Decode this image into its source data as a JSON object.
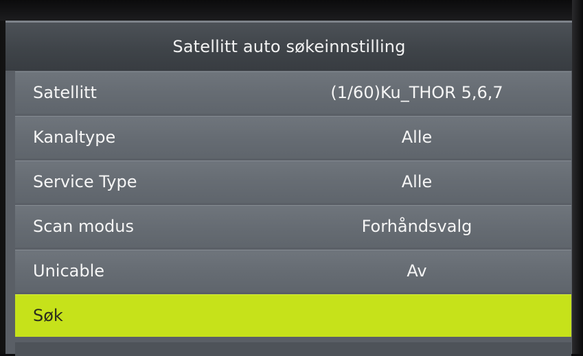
{
  "menu": {
    "title": "Satellitt auto søkeinnstilling",
    "rows": [
      {
        "label": "Satellitt",
        "value": "(1/60)Ku_THOR 5,6,7"
      },
      {
        "label": "Kanaltype",
        "value": "Alle"
      },
      {
        "label": "Service Type",
        "value": "Alle"
      },
      {
        "label": "Scan modus",
        "value": "Forhåndsvalg"
      },
      {
        "label": "Unicable",
        "value": "Av"
      },
      {
        "label": "Søk",
        "value": ""
      }
    ],
    "selected_index": 5,
    "highlight_color": "#c6e21a"
  }
}
